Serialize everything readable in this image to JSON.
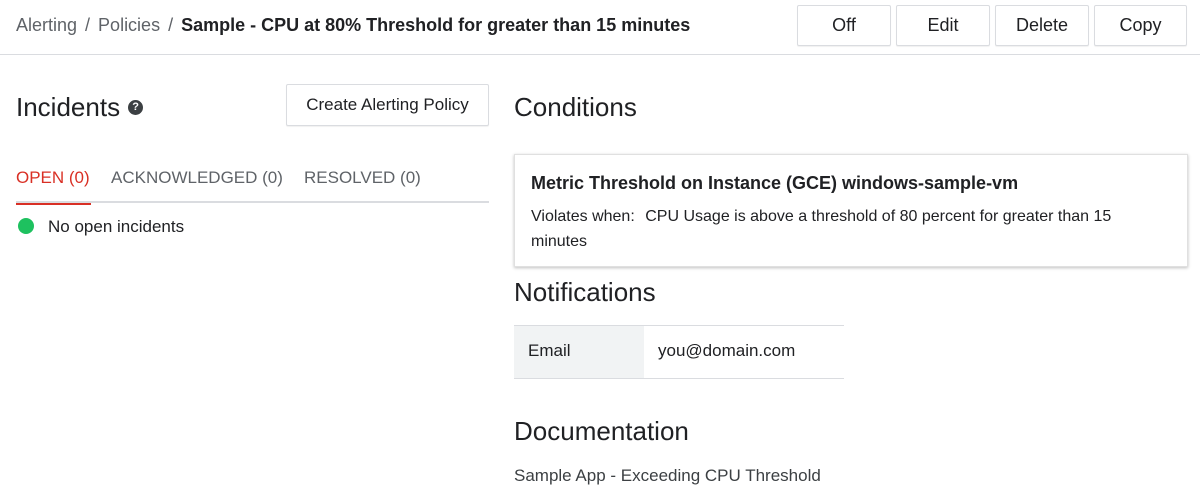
{
  "breadcrumb": {
    "items": [
      "Alerting",
      "Policies"
    ],
    "separator": "/",
    "current": "Sample - CPU at 80% Threshold for greater than 15 minutes"
  },
  "toolbar": {
    "off_label": "Off",
    "edit_label": "Edit",
    "delete_label": "Delete",
    "copy_label": "Copy"
  },
  "incidents": {
    "title": "Incidents",
    "help_icon": "?",
    "create_button": "Create Alerting Policy",
    "tabs": [
      {
        "label": "OPEN (0)",
        "active": true
      },
      {
        "label": "ACKNOWLEDGED (0)",
        "active": false
      },
      {
        "label": "RESOLVED (0)",
        "active": false
      }
    ],
    "empty_message": "No open incidents",
    "status_color": "#1ec15f"
  },
  "conditions": {
    "title": "Conditions",
    "items": [
      {
        "name": "Metric Threshold on Instance (GCE) windows-sample-vm",
        "violates_label": "Violates when:",
        "violates_text": "CPU Usage is above a threshold of 80 percent for greater than 15 minutes"
      }
    ]
  },
  "notifications": {
    "title": "Notifications",
    "rows": [
      {
        "type": "Email",
        "value": "you@domain.com"
      }
    ]
  },
  "documentation": {
    "title": "Documentation",
    "text": "Sample App - Exceeding CPU Threshold"
  },
  "colors": {
    "accent_red": "#d93025",
    "border": "#dadce0"
  }
}
